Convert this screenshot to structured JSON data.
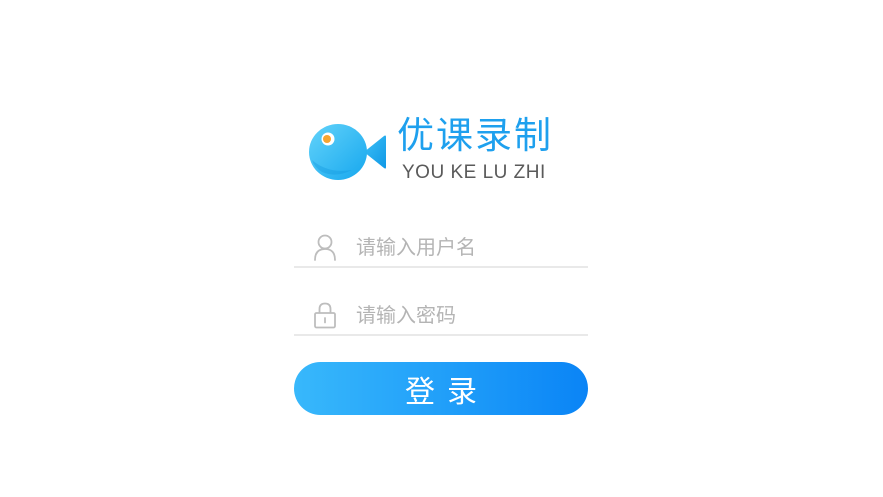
{
  "brand": {
    "title": "优课录制",
    "subtitle": "YOU KE LU ZHI",
    "logo_icon": "fish-camera-icon",
    "accent_color": "#1ea0ee"
  },
  "form": {
    "username": {
      "icon": "user-icon",
      "placeholder": "请输入用户名",
      "value": ""
    },
    "password": {
      "icon": "lock-icon",
      "placeholder": "请输入密码",
      "value": ""
    },
    "submit_label": "登录",
    "button_gradient": [
      "#38b8fb",
      "#0a84f6"
    ]
  }
}
